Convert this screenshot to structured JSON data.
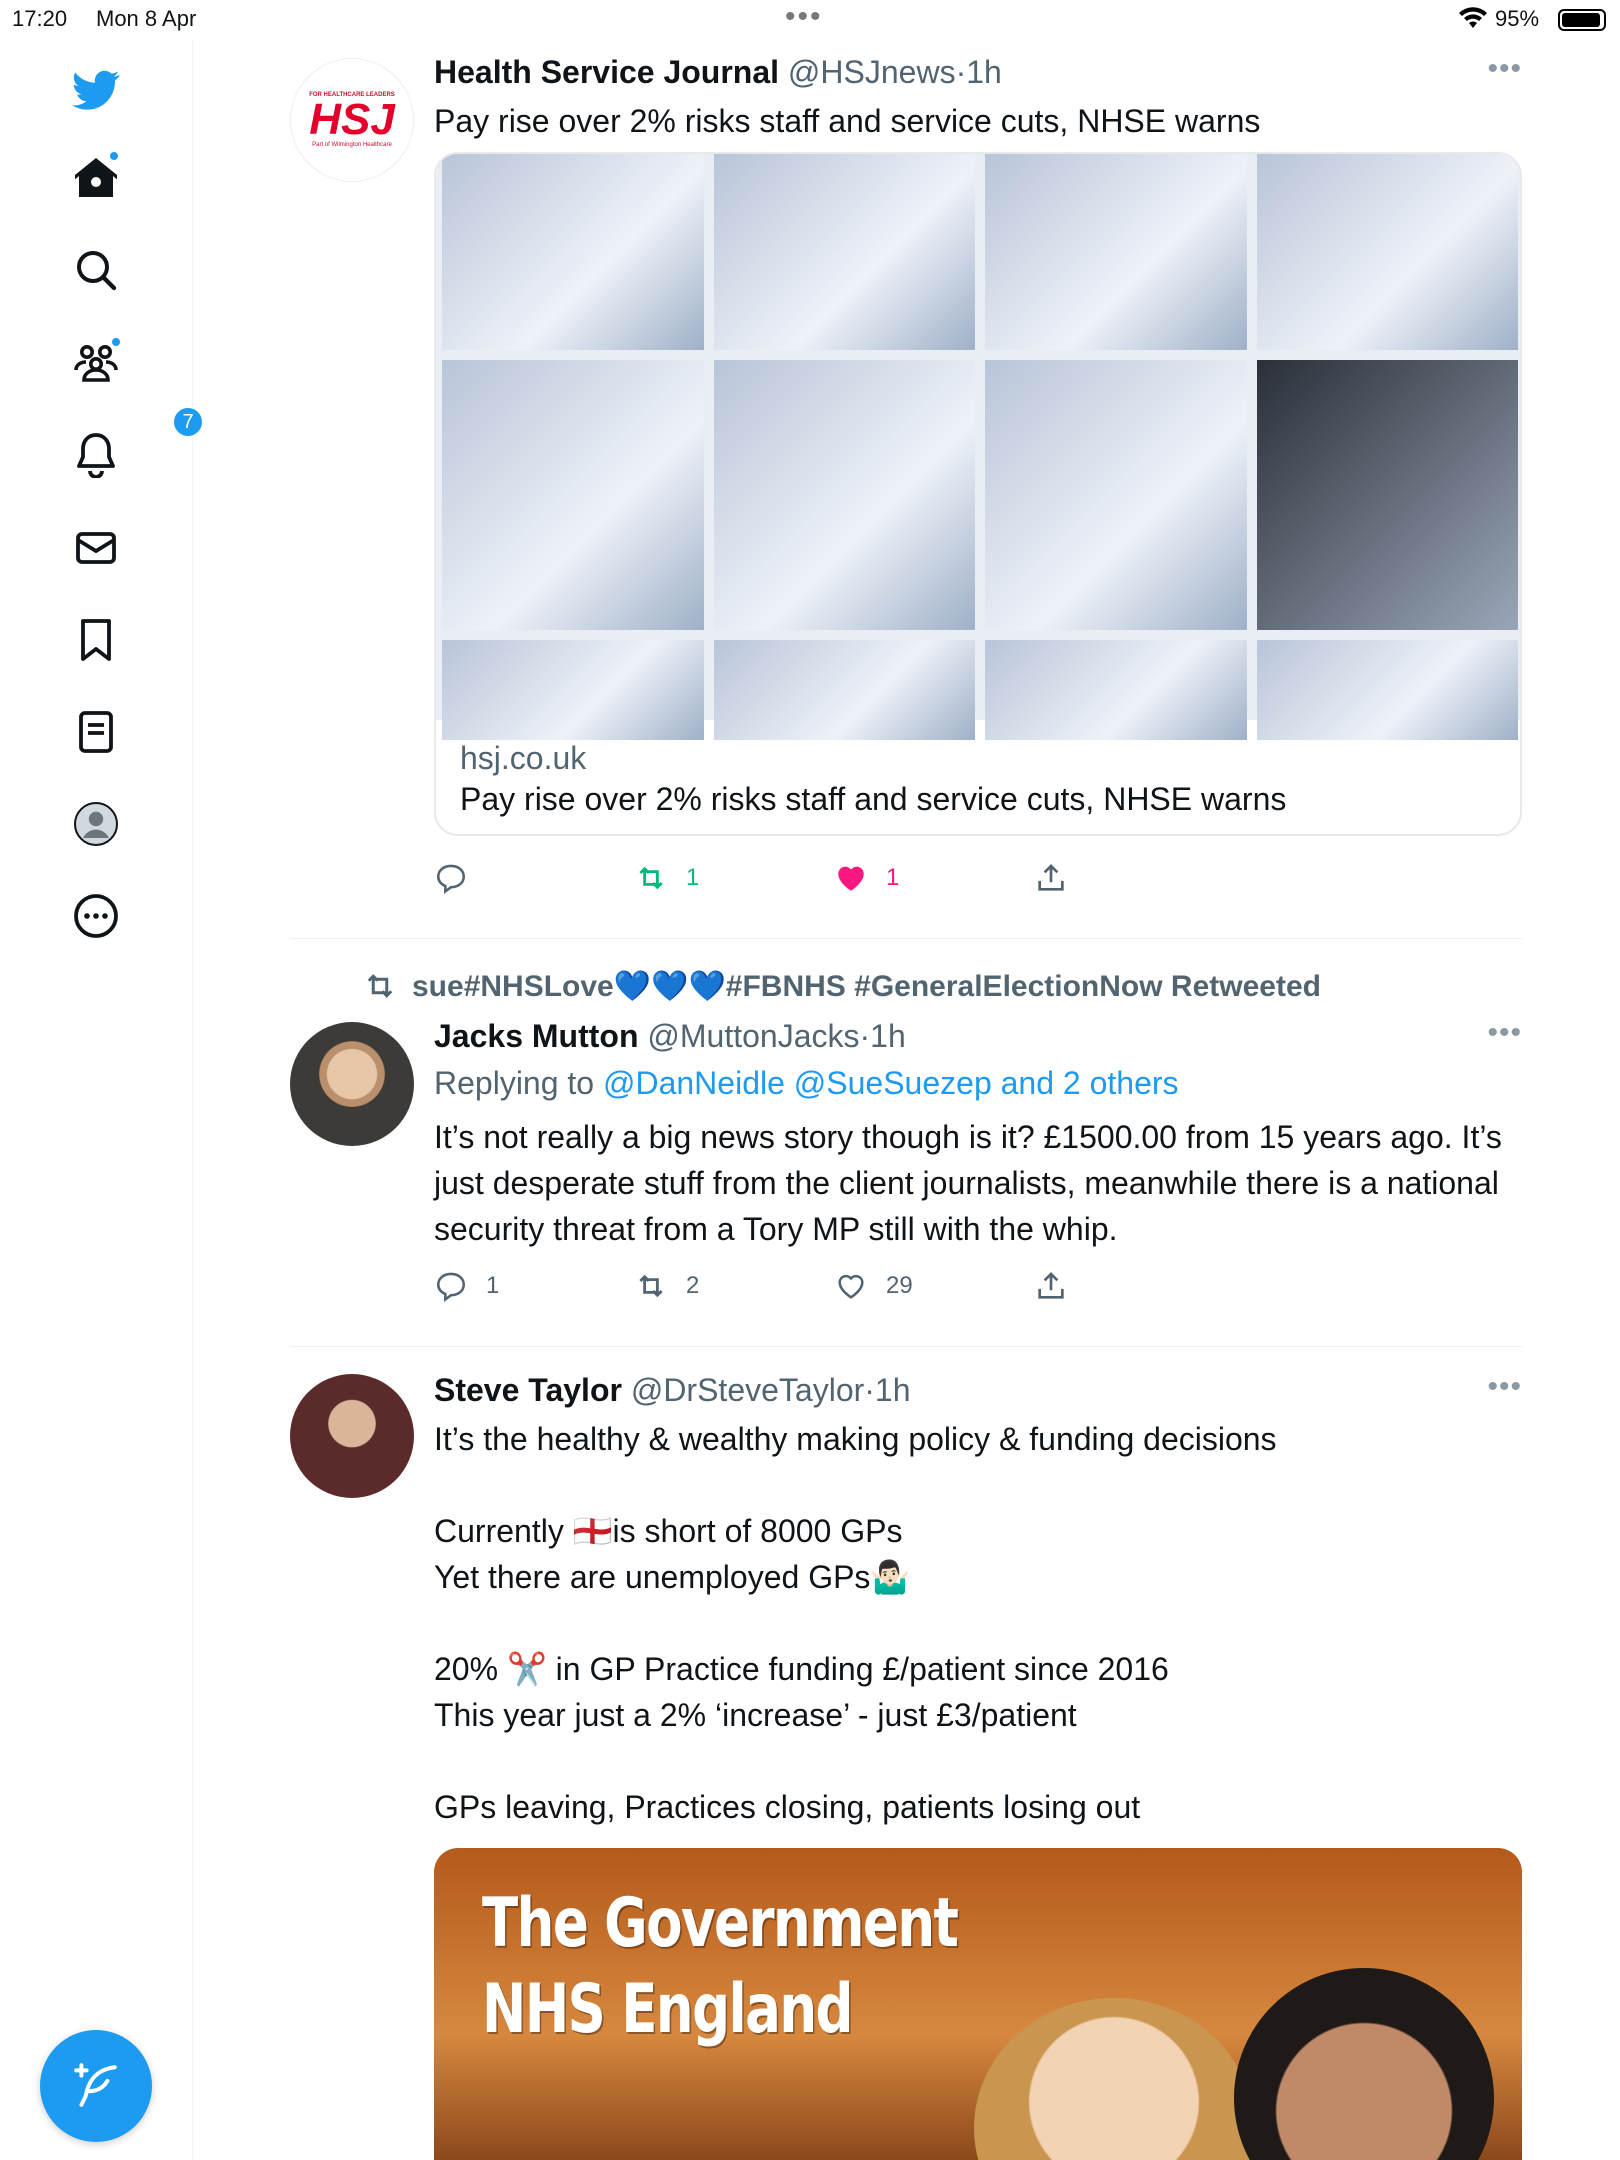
{
  "status_bar": {
    "time": "17:20",
    "date": "Mon 8 Apr",
    "battery": "95%"
  },
  "sidebar": {
    "notifications_badge": "7",
    "items": [
      "twitter-logo",
      "home",
      "explore",
      "communities",
      "notifications",
      "messages",
      "bookmarks",
      "lists",
      "profile",
      "more"
    ]
  },
  "tweets": [
    {
      "name": "Health Service Journal",
      "handle": "@HSJnews",
      "time": "1h",
      "avatar_text": "HSJ",
      "avatar_top": "FOR HEALTHCARE LEADERS",
      "avatar_bottom": "Part of Wilmington Healthcare",
      "text": "Pay rise over 2% risks staff and service cuts, NHSE warns",
      "card": {
        "domain": "hsj.co.uk",
        "title": "Pay rise over 2% risks staff and service cuts, NHSE warns"
      },
      "actions": {
        "replies": "",
        "retweets": "1",
        "likes": "1"
      }
    },
    {
      "retweeted_by": "sue#NHSLove💙💙💙#FBNHS #GeneralElectionNow Retweeted",
      "name": "Jacks Mutton",
      "handle": "@MuttonJacks",
      "time": "1h",
      "replying_label": "Replying to",
      "replying_to": "@DanNeidle @SueSuezep and 2 others",
      "text": "It’s not really a big news story though is it? £1500.00 from 15 years ago. It’s just desperate stuff from the client journalists, meanwhile there is a national security threat from a Tory MP still with the whip.",
      "actions": {
        "replies": "1",
        "retweets": "2",
        "likes": "29"
      }
    },
    {
      "name": "Steve Taylor",
      "handle": "@DrSteveTaylor",
      "time": "1h",
      "text": "It’s the healthy & wealthy making policy & funding decisions\n\nCurrently 🏴󠁧󠁢󠁥󠁮󠁧󠁿is short of 8000 GPs\nYet there are unemployed GPs🤷🏻‍♂️\n\n20% ✂️ in GP Practice funding £/patient since 2016\nThis year just a 2% ‘increase’ - just £3/patient\n\nGPs leaving, Practices closing, patients losing out",
      "image_line1": "The Government",
      "image_line2": "NHS England"
    }
  ],
  "colors": {
    "accent": "#1d9bf0",
    "retweet": "#00ba7c",
    "like": "#f91880",
    "muted": "#536471"
  }
}
